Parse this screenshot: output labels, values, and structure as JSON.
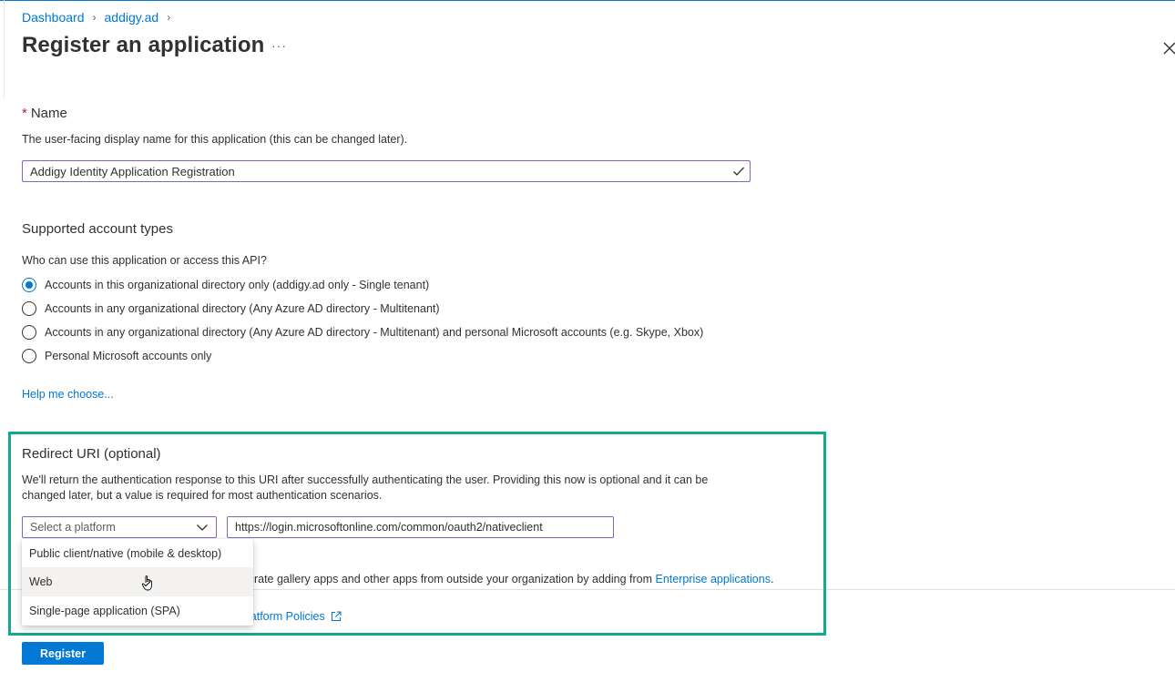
{
  "breadcrumb": {
    "items": [
      "Dashboard",
      "addigy.ad"
    ]
  },
  "page": {
    "title": "Register an application",
    "more": "···"
  },
  "name_section": {
    "label": "Name",
    "required_mark": "*",
    "description": "The user-facing display name for this application (this can be changed later).",
    "value": "Addigy Identity Application Registration"
  },
  "account_types": {
    "label": "Supported account types",
    "question": "Who can use this application or access this API?",
    "options": [
      "Accounts in this organizational directory only (addigy.ad only - Single tenant)",
      "Accounts in any organizational directory (Any Azure AD directory - Multitenant)",
      "Accounts in any organizational directory (Any Azure AD directory - Multitenant) and personal Microsoft accounts (e.g. Skype, Xbox)",
      "Personal Microsoft accounts only"
    ],
    "selected_index": 0,
    "help_link": "Help me choose..."
  },
  "redirect": {
    "label": "Redirect URI (optional)",
    "description_line1": "We'll return the authentication response to this URI after successfully authenticating the user. Providing this now is optional and it can be",
    "description_line2": "changed later, but a value is required for most authentication scenarios.",
    "platform_placeholder": "Select a platform",
    "uri_value": "https://login.microsoftonline.com/common/oauth2/nativeclient",
    "platform_options": [
      "Public client/native (mobile & desktop)",
      "Web",
      "Single-page application (SPA)"
    ],
    "hovered_index": 1
  },
  "behind_dropdown": {
    "text": "grate gallery apps and other apps from outside your organization by adding from ",
    "link": "Enterprise applications",
    "suffix": ".",
    "policies_link": "latform Policies"
  },
  "footer": {
    "register_label": "Register"
  },
  "colors": {
    "accent": "#0078d4",
    "highlight": "#14a88e",
    "input_border": "#8764b8",
    "required": "#a4262c"
  }
}
